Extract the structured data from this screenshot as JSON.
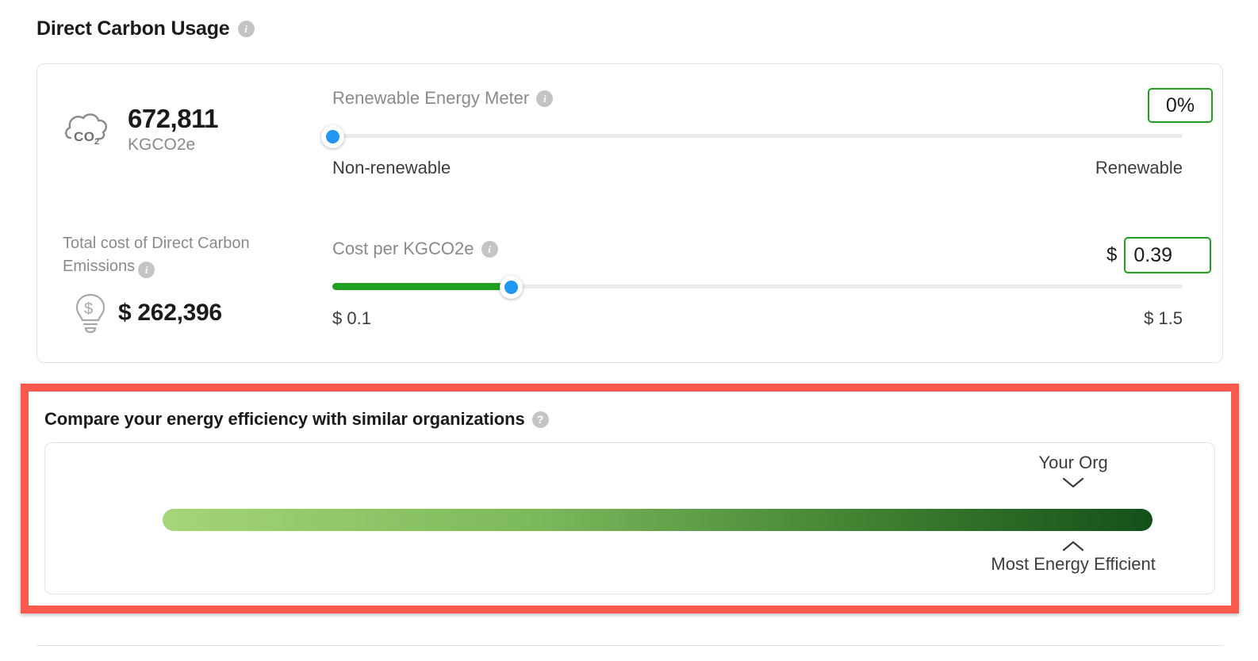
{
  "section": {
    "title": "Direct Carbon Usage",
    "info_icon": "info-icon"
  },
  "metrics": {
    "carbon": {
      "icon": "co2-cloud-icon",
      "value": "672,811",
      "unit": "KGCO2e"
    },
    "total_cost": {
      "label": "Total cost of Direct Carbon Emissions",
      "icon": "lightbulb-dollar-icon",
      "value": "$ 262,396"
    }
  },
  "renewable_slider": {
    "label": "Renewable Energy Meter",
    "min_label": "Non-renewable",
    "max_label": "Renewable",
    "value_percent": 0,
    "input_value": "0%",
    "input_placeholder": "0%",
    "fill_color": "#22a022",
    "handle_color": "#2196f3"
  },
  "cost_slider": {
    "label": "Cost per KGCO2e",
    "min_label": "$ 0.1",
    "max_label": "$ 1.5",
    "value_percent": 21,
    "currency_symbol": "$",
    "input_value": "0.39",
    "input_placeholder": "0.39",
    "fill_color": "#22a022",
    "handle_color": "#2196f3"
  },
  "compare": {
    "title": "Compare your energy efficiency with similar organizations",
    "help_icon": "question-mark-icon",
    "marker_top_label": "Your Org",
    "marker_bottom_label": "Most Energy Efficient",
    "gradient_from": "#a6d47a",
    "gradient_to": "#14501a",
    "highlight_color": "#fa5a4d",
    "marker_position_percent": 92
  }
}
